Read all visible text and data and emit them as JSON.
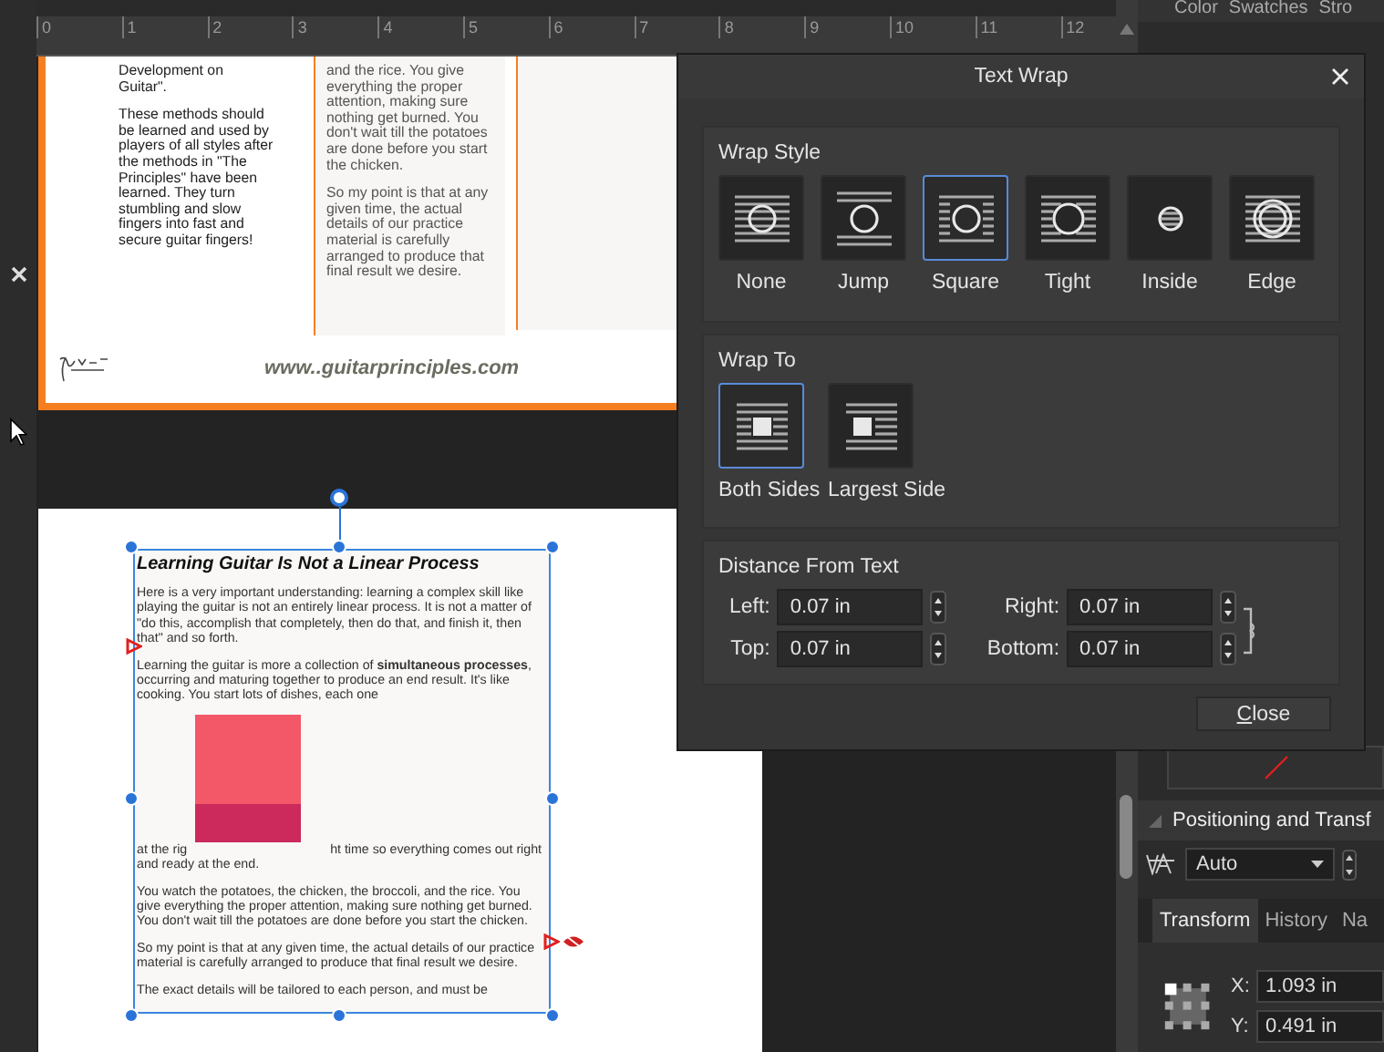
{
  "ruler": {
    "labels": [
      "0",
      "1",
      "2",
      "3",
      "4",
      "5",
      "6",
      "7",
      "8",
      "9",
      "10",
      "11",
      "12"
    ]
  },
  "upper_page": {
    "column_1": [
      "Development on Guitar\".",
      "These methods should be learned and used by players of all styles after the methods in \"The Principles\" have been learned. They turn stumbling and slow fingers into fast and secure guitar fingers!"
    ],
    "column_2": [
      "and the rice. You give everything the proper attention, making sure nothing get burned. You don't wait till the potatoes are done before you start the chicken.",
      "So my point is that at any given time, the actual details of our practice material is carefully arranged to produce that final result we desire."
    ],
    "footer_url": "www..guitarprinciples.com"
  },
  "lower_page": {
    "title": "Learning Guitar Is Not a Linear Process",
    "paragraphs_before": [
      "Here is a very important understanding: learning a complex skill like playing the guitar is not an entirely linear process. It is not a matter of \"do this, accomplish that completely, then do that, and finish it, then that\" and so forth.",
      "Learning the guitar is more a collection of **simultaneous processes**, occurring and maturing together to produce an end result. It's like cooking. You start lots of dishes, each one"
    ],
    "wrap_line": [
      "at the rig",
      "ht time so everything comes out right"
    ],
    "paragraphs_after": [
      "and ready at the end.",
      "You watch the potatoes, the chicken, the broccoli, and the rice. You give everything the proper attention, making sure nothing get burned. You don't wait till the potatoes are done before you start the chicken.",
      "So my point is that at any given time, the actual details of our practice material is carefully arranged to produce that final result we desire.",
      "The exact details will be tailored to each person, and must be"
    ]
  },
  "text_wrap_dialog": {
    "title": "Text Wrap",
    "wrap_style": {
      "heading": "Wrap Style",
      "options": [
        {
          "label": "None",
          "kind": "none",
          "selected": false
        },
        {
          "label": "Jump",
          "kind": "jump",
          "selected": false
        },
        {
          "label": "Square",
          "kind": "square",
          "selected": true
        },
        {
          "label": "Tight",
          "kind": "tight",
          "selected": false
        },
        {
          "label": "Inside",
          "kind": "inside",
          "selected": false
        },
        {
          "label": "Edge",
          "kind": "edge",
          "selected": false
        }
      ]
    },
    "wrap_to": {
      "heading": "Wrap To",
      "options": [
        {
          "label": "Both Sides",
          "kind": "both",
          "selected": true
        },
        {
          "label": "Largest Side",
          "kind": "largest",
          "selected": false
        }
      ]
    },
    "distance": {
      "heading": "Distance From Text",
      "values_linked": true,
      "fields": [
        {
          "label": "Left:",
          "value": "0.07 in"
        },
        {
          "label": "Right:",
          "value": "0.07 in"
        },
        {
          "label": "Top:",
          "value": "0.07 in"
        },
        {
          "label": "Bottom:",
          "value": "0.07 in"
        }
      ]
    },
    "close_button": "Close"
  },
  "right_panel": {
    "tabs": [
      "Color",
      "Swatches",
      "Stro"
    ],
    "section_title": "Positioning and Transf",
    "dropdown": "Auto",
    "panel_tabs": [
      {
        "label": "Transform",
        "selected": true
      },
      {
        "label": "History",
        "selected": false
      },
      {
        "label": "Na",
        "selected": false
      }
    ],
    "fields": [
      {
        "label": "X:",
        "value": "1.093 in"
      },
      {
        "label": "Y:",
        "value": "0.491 in"
      }
    ]
  }
}
